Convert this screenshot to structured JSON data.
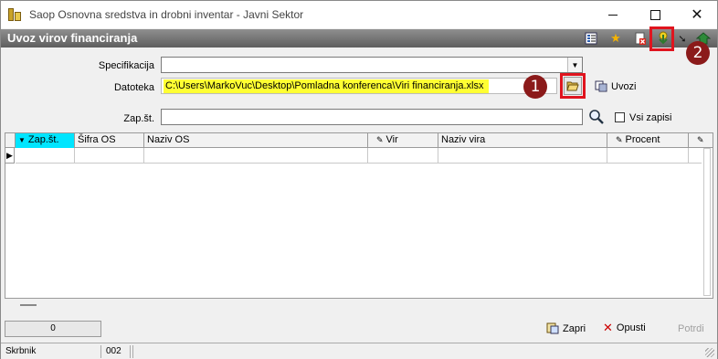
{
  "window": {
    "title": "Saop Osnovna sredstva in drobni inventar - Javni Sektor",
    "min_icon": "minimize-icon",
    "max_icon": "maximize-icon",
    "close_glyph": "✕"
  },
  "header": {
    "title": "Uvoz virov financiranja",
    "icons": [
      "list-icon",
      "star-icon",
      "close-doc-icon",
      "import-icon",
      "arrow-icon",
      "exit-icon"
    ],
    "badge_2": "2"
  },
  "form": {
    "specifikacija_label": "Specifikacija",
    "specifikacija_value": "",
    "datoteka_label": "Datoteka",
    "datoteka_value": "C:\\Users\\MarkoVuc\\Desktop\\Pomladna konferenca\\Viri financiranja.xlsx",
    "badge_1": "1",
    "uvozi_label": "Uvozi",
    "zapst_label": "Zap.št.",
    "zapst_value": "",
    "vsi_zapisi_label": "Vsi zapisi"
  },
  "grid": {
    "columns": [
      "Zap.št.",
      "Šifra OS",
      "Naziv OS",
      "Vir",
      "Naziv vira",
      "Procent"
    ],
    "sort_indicator": "▼"
  },
  "footer": {
    "count": "0",
    "zapri_label": "Zapri",
    "opusti_label": "Opusti",
    "potrdi_label": "Potrdi"
  },
  "status": {
    "user": "Skrbnik",
    "code": "002"
  }
}
